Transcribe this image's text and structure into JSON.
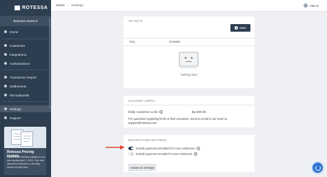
{
  "sidebar": {
    "logo": "ROTESSA",
    "business_name": "Business Name",
    "items": [
      {
        "label": "Home",
        "icon": "home-icon"
      },
      {
        "label": "Customers",
        "icon": "users-icon"
      },
      {
        "label": "Integrations",
        "icon": "plug-icon"
      },
      {
        "label": "Authorizations",
        "icon": "key-icon"
      },
      {
        "label": "Transaction Report",
        "icon": "report-icon"
      },
      {
        "label": "Settlements",
        "icon": "bank-icon"
      },
      {
        "label": "Microdeposits",
        "icon": "coins-icon"
      },
      {
        "label": "Settings",
        "icon": "gear-icon"
      },
      {
        "label": "Support",
        "icon": "help-icon"
      }
    ],
    "active_item": "Settings",
    "promo": {
      "title": "Rotessa Pricing Update",
      "body": "We are implementing changes to our new starting April 1, 2024. Your new rate will be reflected on the May invoice for April fees."
    }
  },
  "header": {
    "breadcrumb_home": "Home",
    "breadcrumb_current": "Settings",
    "user_name": "Alex E"
  },
  "api_keys": {
    "title": "API KEYS",
    "new_button": "New",
    "columns": [
      "Key",
      "Created"
    ],
    "empty_text": "Nothing here"
  },
  "account_limits": {
    "title": "ACCOUNT LIMITS",
    "limit_label": "Daily Customer Limit",
    "limit_value": "$2,500.00",
    "note": "For questions regarding limits or limit increases, send an email to our team at support@rotessa.com"
  },
  "notifications": {
    "title": "NOTIFICATION SETTINGS",
    "toggles": [
      {
        "label": "Enable payment reminders for new customers",
        "enabled": true
      },
      {
        "label": "Enable payment receipts for new customers",
        "enabled": false
      }
    ],
    "advanced_button": "Advanced Settings"
  },
  "colors": {
    "sidebar": "#2c3e50",
    "accent": "#2c3e50",
    "arrow": "#e1432f",
    "help": "#2f74d0"
  }
}
